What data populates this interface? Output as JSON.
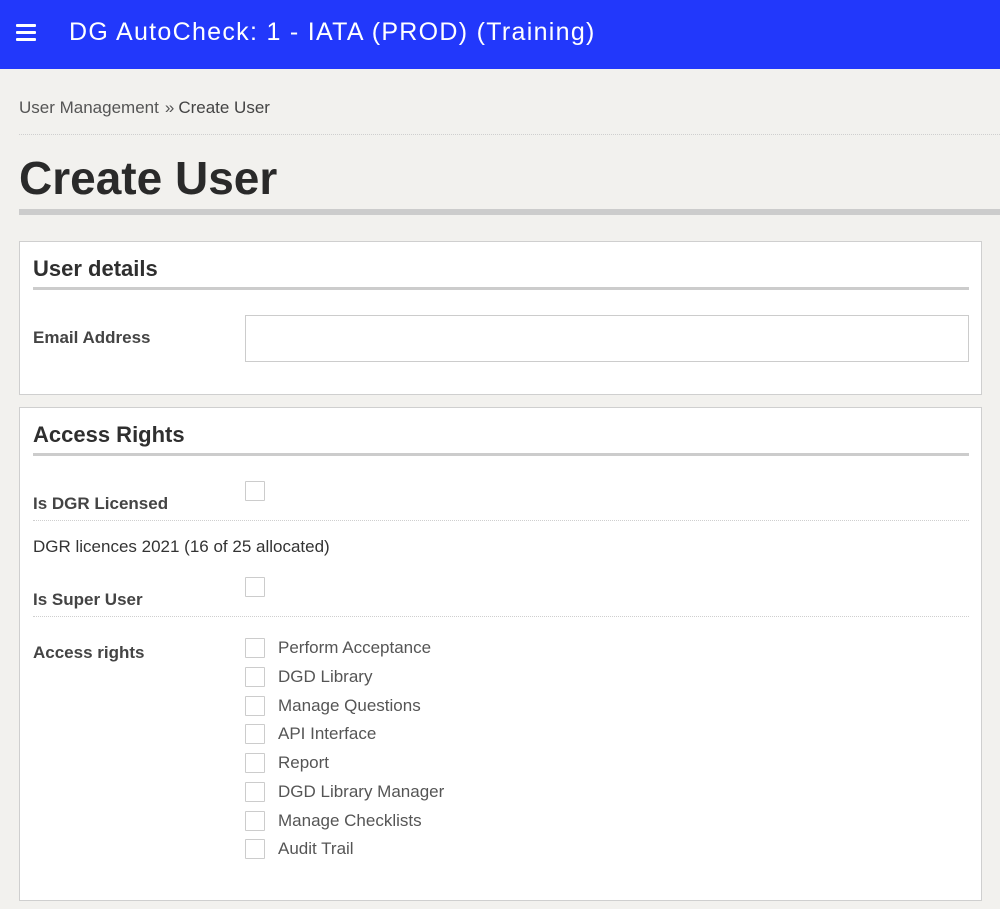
{
  "header": {
    "app_title": "DG AutoCheck: 1 - IATA (PROD) (Training)",
    "menu_icon": "hamburger-menu-icon",
    "background_color": "#2238fb"
  },
  "breadcrumb": {
    "parent": "User Management",
    "separator": "»",
    "current": "Create User"
  },
  "page_title": "Create User",
  "user_details": {
    "heading": "User details",
    "email_label": "Email Address",
    "email_value": "",
    "email_placeholder": ""
  },
  "access_rights": {
    "heading": "Access Rights",
    "dgr_licensed_label": "Is DGR Licensed",
    "dgr_licensed_checked": false,
    "licence_info": "DGR licences 2021 (16 of 25 allocated)",
    "super_user_label": "Is Super User",
    "super_user_checked": false,
    "rights_label": "Access rights",
    "rights": [
      {
        "label": "Perform Acceptance",
        "checked": false
      },
      {
        "label": "DGD Library",
        "checked": false
      },
      {
        "label": "Manage Questions",
        "checked": false
      },
      {
        "label": "API Interface",
        "checked": false
      },
      {
        "label": "Report",
        "checked": false
      },
      {
        "label": "DGD Library Manager",
        "checked": false
      },
      {
        "label": "Manage Checklists",
        "checked": false
      },
      {
        "label": "Audit Trail",
        "checked": false
      }
    ]
  }
}
